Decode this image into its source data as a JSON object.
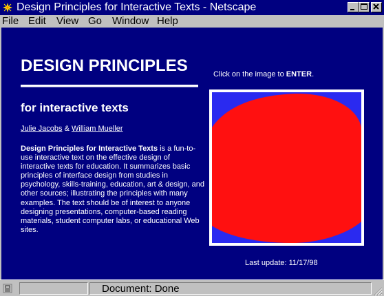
{
  "window": {
    "title": "Design Principles for Interactive Texts - Netscape",
    "icon": "netscape-icon",
    "controls": [
      "minimize-icon",
      "maximize-icon",
      "close-icon"
    ]
  },
  "menu": [
    "File",
    "Edit",
    "View",
    "Go",
    "Window",
    "Help"
  ],
  "page": {
    "heading": "DESIGN PRINCIPLES",
    "subheading": "for interactive texts",
    "author1": "Julie Jacobs",
    "author_sep": " & ",
    "author2": "William Mueller",
    "desc_title": "Design Principles for Interactive Texts",
    "desc_body": " is a fun-to-use interactive text on the effective design of interactive texts for education. It summarizes basic principles of interface design from studies in psychology, skills-training, education, art & design, and other sources; illustrating the principles with many examples. The text should be of interest to anyone designing presentations, computer-based reading materials, student computer labs, or educational Web sites.",
    "click_prefix": "Click on the image to ",
    "click_emph": "ENTER",
    "click_suffix": ".",
    "last_update": "Last update: 11/17/98"
  },
  "colors": {
    "page_background": "#000080",
    "image_blue": "#2a2af0",
    "image_red": "#ff1010",
    "image_border": "#ffffff"
  },
  "status": {
    "text": "Document: Done",
    "icons": [
      "security-lock-icon",
      "resize-grip-icon"
    ]
  }
}
